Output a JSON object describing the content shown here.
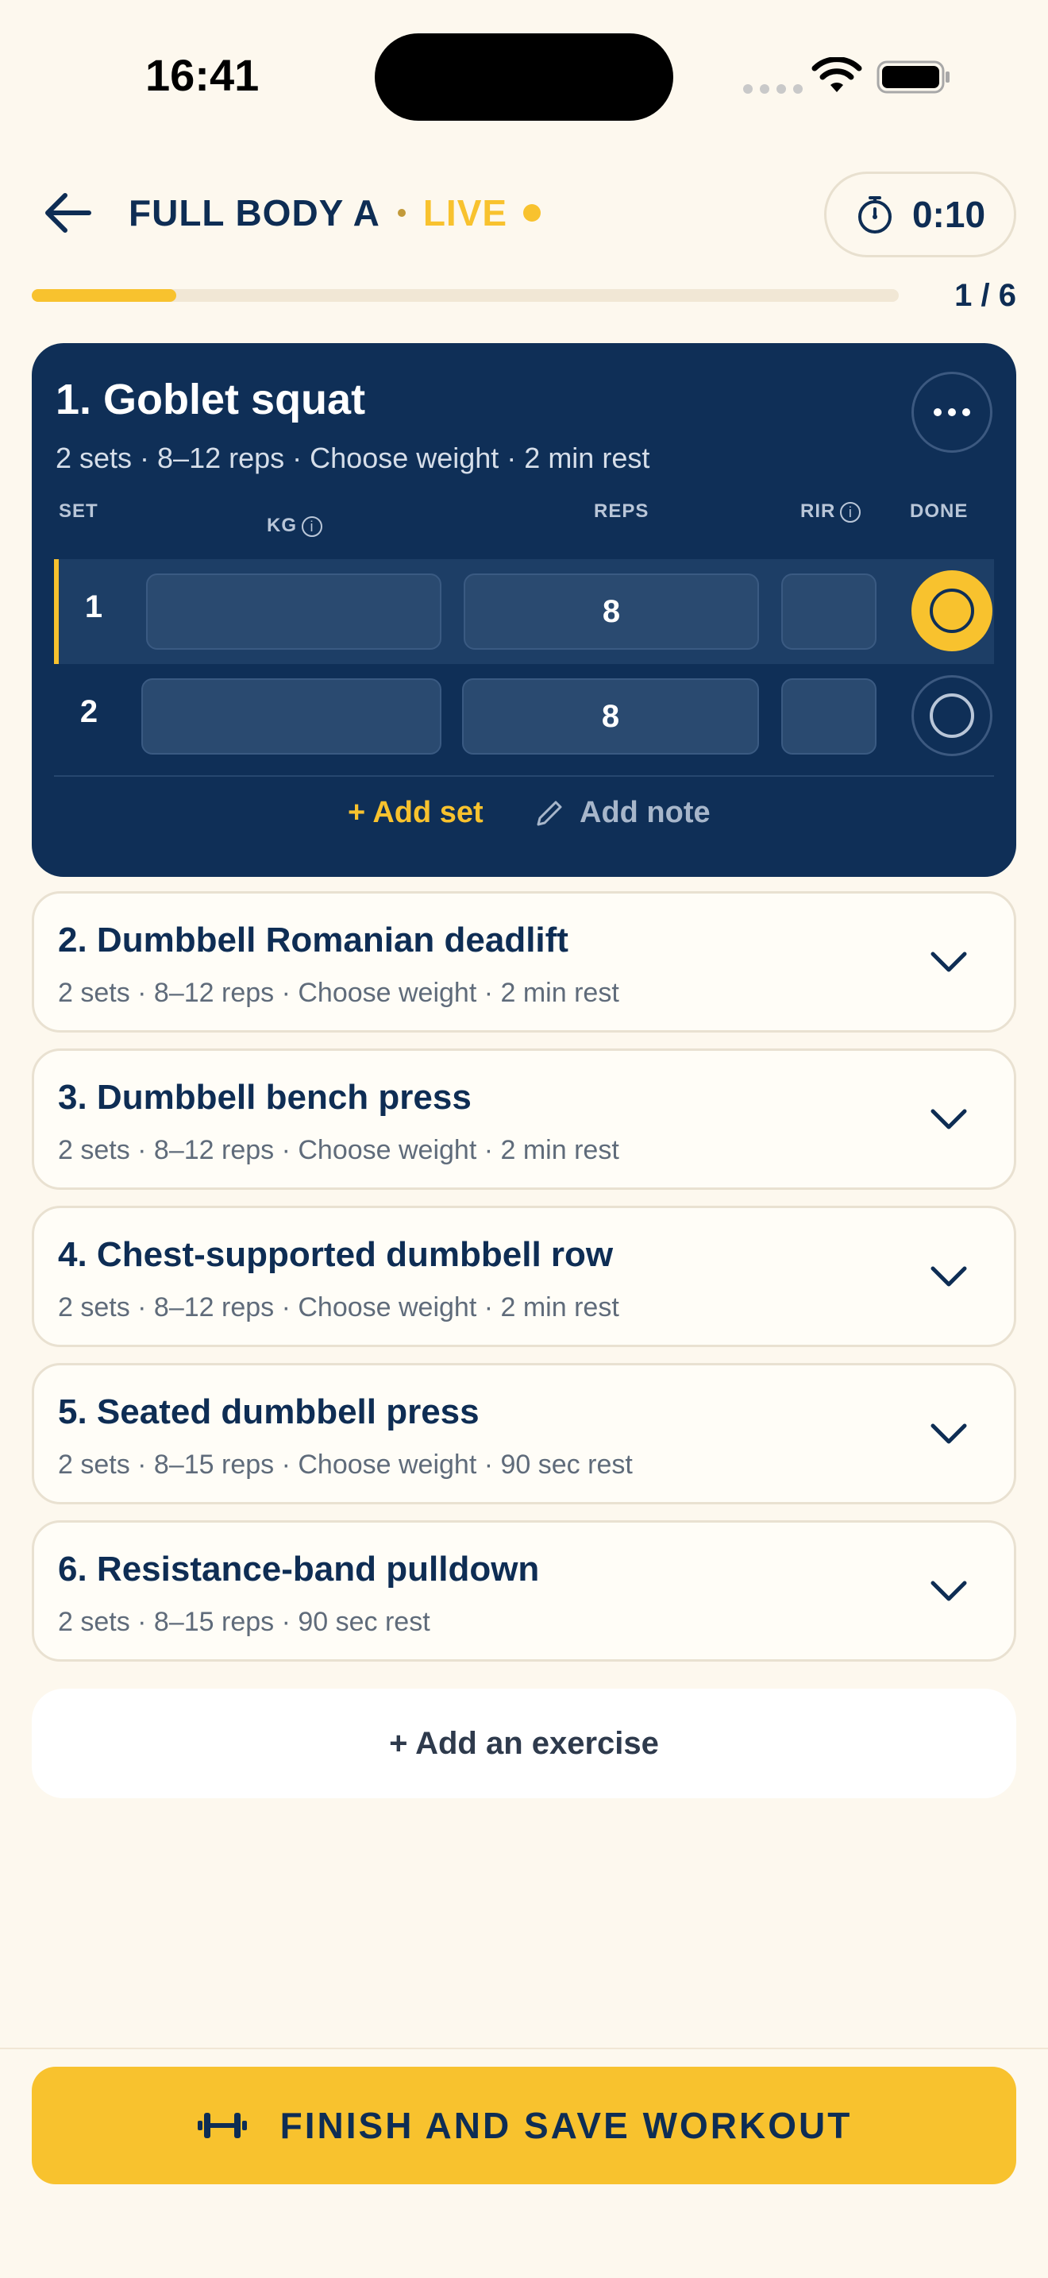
{
  "status_bar": {
    "time": "16:41"
  },
  "header": {
    "workout_title": "FULL BODY A",
    "live_label": "LIVE",
    "timer": "0:10",
    "progress_count": "1 / 6",
    "progress_fraction": 0.1667
  },
  "active_exercise": {
    "title": "1. Goblet squat",
    "subtitle": "2 sets · 8–12 reps · Choose weight · 2 min rest",
    "columns": {
      "set": "SET",
      "kg": "KG",
      "reps": "REPS",
      "rir": "RIR",
      "done": "DONE"
    },
    "sets": [
      {
        "number": "1",
        "kg": "",
        "reps": "8",
        "rir": "",
        "done": false,
        "current": true
      },
      {
        "number": "2",
        "kg": "",
        "reps": "8",
        "rir": "",
        "done": false,
        "current": false
      }
    ],
    "add_set_label": "+ Add set",
    "add_note_label": "Add note"
  },
  "exercises": [
    {
      "title": "2. Dumbbell Romanian deadlift",
      "subtitle": "2 sets · 8–12 reps · Choose weight · 2 min rest"
    },
    {
      "title": "3. Dumbbell bench press",
      "subtitle": "2 sets · 8–12 reps · Choose weight · 2 min rest"
    },
    {
      "title": "4. Chest-supported dumbbell row",
      "subtitle": "2 sets · 8–12 reps · Choose weight · 2 min rest"
    },
    {
      "title": "5. Seated dumbbell press",
      "subtitle": "2 sets · 8–15 reps · Choose weight · 90 sec rest"
    },
    {
      "title": "6. Resistance-band pulldown",
      "subtitle": "2 sets · 8–15 reps · 90 sec rest"
    }
  ],
  "add_exercise_label": "+ Add an exercise",
  "finish_label": "FINISH AND SAVE WORKOUT",
  "colors": {
    "navy": "#0F2F57",
    "accent": "#F8C22E",
    "background": "#FDF8EE"
  },
  "icons": [
    "back-arrow-icon",
    "stopwatch-icon",
    "more-icon",
    "pencil-icon",
    "chevron-down-icon",
    "dumbbell-icon",
    "info-icon",
    "wifi-icon",
    "battery-icon"
  ]
}
